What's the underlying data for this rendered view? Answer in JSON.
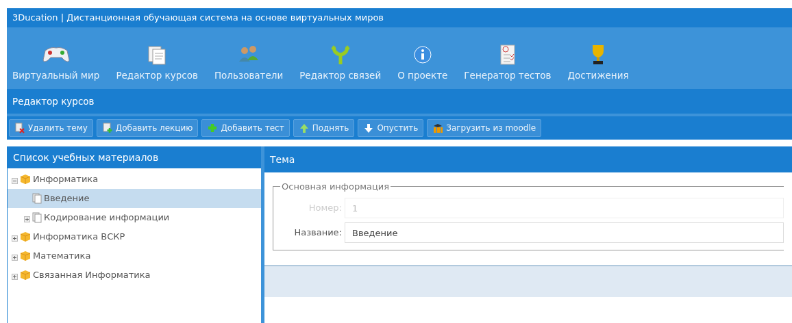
{
  "window": {
    "title": "3Ducation | Дистанционная обучающая система на основе виртуальных миров"
  },
  "nav": [
    {
      "label": "Виртуальный мир",
      "kind": "gamepad"
    },
    {
      "label": "Редактор курсов",
      "kind": "documents"
    },
    {
      "label": "Пользователи",
      "kind": "users"
    },
    {
      "label": "Редактор связей",
      "kind": "fork"
    },
    {
      "label": "О проекте",
      "kind": "info"
    },
    {
      "label": "Генератор тестов",
      "kind": "test"
    },
    {
      "label": "Достижения",
      "kind": "trophy"
    }
  ],
  "section_title": "Редактор курсов",
  "toolbar": [
    {
      "label": "Удалить тему",
      "kind": "delete"
    },
    {
      "label": "Добавить лекцию",
      "kind": "add-doc"
    },
    {
      "label": "Добавить тест",
      "kind": "plus"
    },
    {
      "label": "Поднять",
      "kind": "up"
    },
    {
      "label": "Опустить",
      "kind": "down"
    },
    {
      "label": "Загрузить из moodle",
      "kind": "moodle"
    }
  ],
  "sidebar": {
    "title": "Список учебных материалов",
    "items": [
      {
        "label": "Информатика",
        "kind": "course",
        "expanded": true,
        "selected": false,
        "children": [
          {
            "label": "Введение",
            "kind": "topic",
            "expanded": false,
            "selected": true
          },
          {
            "label": "Кодирование информации",
            "kind": "topic",
            "expanded": false,
            "selected": false
          }
        ]
      },
      {
        "label": "Информатика ВСКР",
        "kind": "course",
        "expanded": false,
        "selected": false
      },
      {
        "label": "Математика",
        "kind": "course",
        "expanded": false,
        "selected": false
      },
      {
        "label": "Связанная Информатика",
        "kind": "course",
        "expanded": false,
        "selected": false
      }
    ]
  },
  "panel": {
    "title": "Тема",
    "fieldset": "Основная информация",
    "fields": [
      {
        "label": "Номер:",
        "value": "1",
        "disabled": true
      },
      {
        "label": "Название:",
        "value": "Введение",
        "disabled": false
      }
    ]
  }
}
